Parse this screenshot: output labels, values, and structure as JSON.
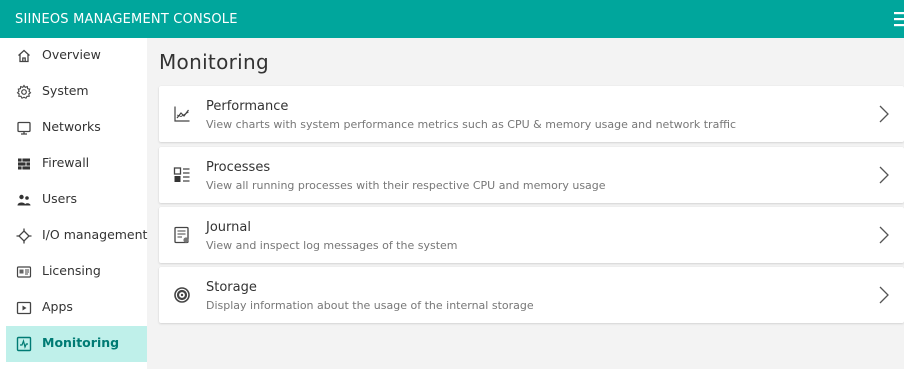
{
  "app": {
    "title": "SIINEOS MANAGEMENT CONSOLE"
  },
  "sidebar": {
    "items": [
      {
        "label": "Overview",
        "icon": "home-icon"
      },
      {
        "label": "System",
        "icon": "gear-icon"
      },
      {
        "label": "Networks",
        "icon": "monitor-icon"
      },
      {
        "label": "Firewall",
        "icon": "firewall-icon"
      },
      {
        "label": "Users",
        "icon": "users-icon"
      },
      {
        "label": "I/O management",
        "icon": "io-icon"
      },
      {
        "label": "Licensing",
        "icon": "license-icon"
      },
      {
        "label": "Apps",
        "icon": "apps-icon"
      },
      {
        "label": "Monitoring",
        "icon": "monitoring-icon",
        "active": true
      }
    ]
  },
  "main": {
    "title": "Monitoring",
    "cards": [
      {
        "title": "Performance",
        "description": "View charts with system performance metrics such as CPU & memory usage and network traffic",
        "icon": "chart-icon"
      },
      {
        "title": "Processes",
        "description": "View all running processes with their respective CPU and memory usage",
        "icon": "processes-icon"
      },
      {
        "title": "Journal",
        "description": "View and inspect log messages of the system",
        "icon": "journal-icon"
      },
      {
        "title": "Storage",
        "description": "Display information about the usage of the internal storage",
        "icon": "storage-icon"
      }
    ]
  },
  "colors": {
    "accent": "#00a69c",
    "active_bg": "#bff0ea",
    "active_text": "#007b74"
  }
}
